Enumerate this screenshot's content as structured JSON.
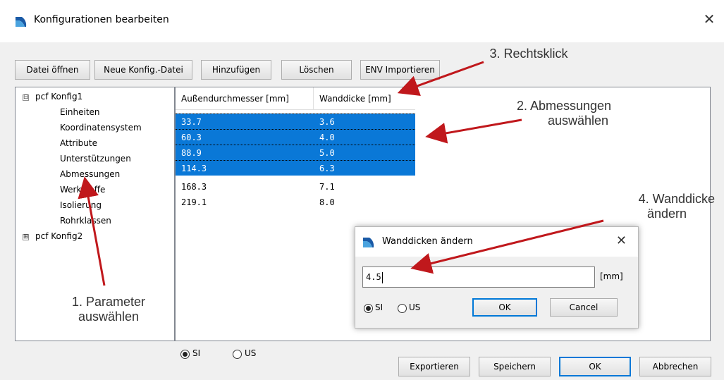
{
  "window": {
    "title": "Konfigurationen bearbeiten",
    "close": "✕",
    "icon": "app-icon"
  },
  "toolbar": {
    "open_file": "Datei öffnen",
    "new_config": "Neue Konfig.-Datei",
    "add": "Hinzufügen",
    "delete": "Löschen",
    "env_import": "ENV Importieren"
  },
  "tree": {
    "config1": {
      "expander": "⊟",
      "label": "pcf Konfig1",
      "children": [
        "Einheiten",
        "Koordinatensystem",
        "Attribute",
        "Unterstützungen",
        "Abmessungen",
        "Werkstoffe",
        "Isolierung",
        "Rohrklassen"
      ]
    },
    "config2": {
      "expander": "⊞",
      "label": "pcf Konfig2"
    }
  },
  "grid": {
    "columns": [
      "Außendurchmesser [mm]",
      "Wanddicke [mm]"
    ],
    "rows": [
      {
        "od": "33.7",
        "wt": "3.6",
        "selected": true
      },
      {
        "od": "60.3",
        "wt": "4.0",
        "selected": true
      },
      {
        "od": "88.9",
        "wt": "5.0",
        "selected": true
      },
      {
        "od": "114.3",
        "wt": "6.3",
        "selected": true
      },
      {
        "od": "168.3",
        "wt": "7.1",
        "selected": false
      },
      {
        "od": "219.1",
        "wt": "8.0",
        "selected": false
      }
    ]
  },
  "units": {
    "si": "SI",
    "us": "US",
    "selected": "SI"
  },
  "bottom": {
    "export": "Exportieren",
    "save": "Speichern",
    "ok": "OK",
    "cancel": "Abbrechen"
  },
  "dialog": {
    "title": "Wanddicken ändern",
    "close": "✕",
    "value": "4.5",
    "unit": "[mm]",
    "si": "SI",
    "us": "US",
    "ok": "OK",
    "cancel": "Cancel"
  },
  "annotations": {
    "step1_line1": "1. Parameter",
    "step1_line2": "auswählen",
    "step2_line1": "2. Abmessungen",
    "step2_line2": "auswählen",
    "step3": "3. Rechtsklick",
    "step4_line1": "4. Wanddicke",
    "step4_line2": "ändern"
  },
  "colors": {
    "selection": "#0a78d7",
    "arrow": "#c0181c",
    "accent": "#0078d7"
  }
}
